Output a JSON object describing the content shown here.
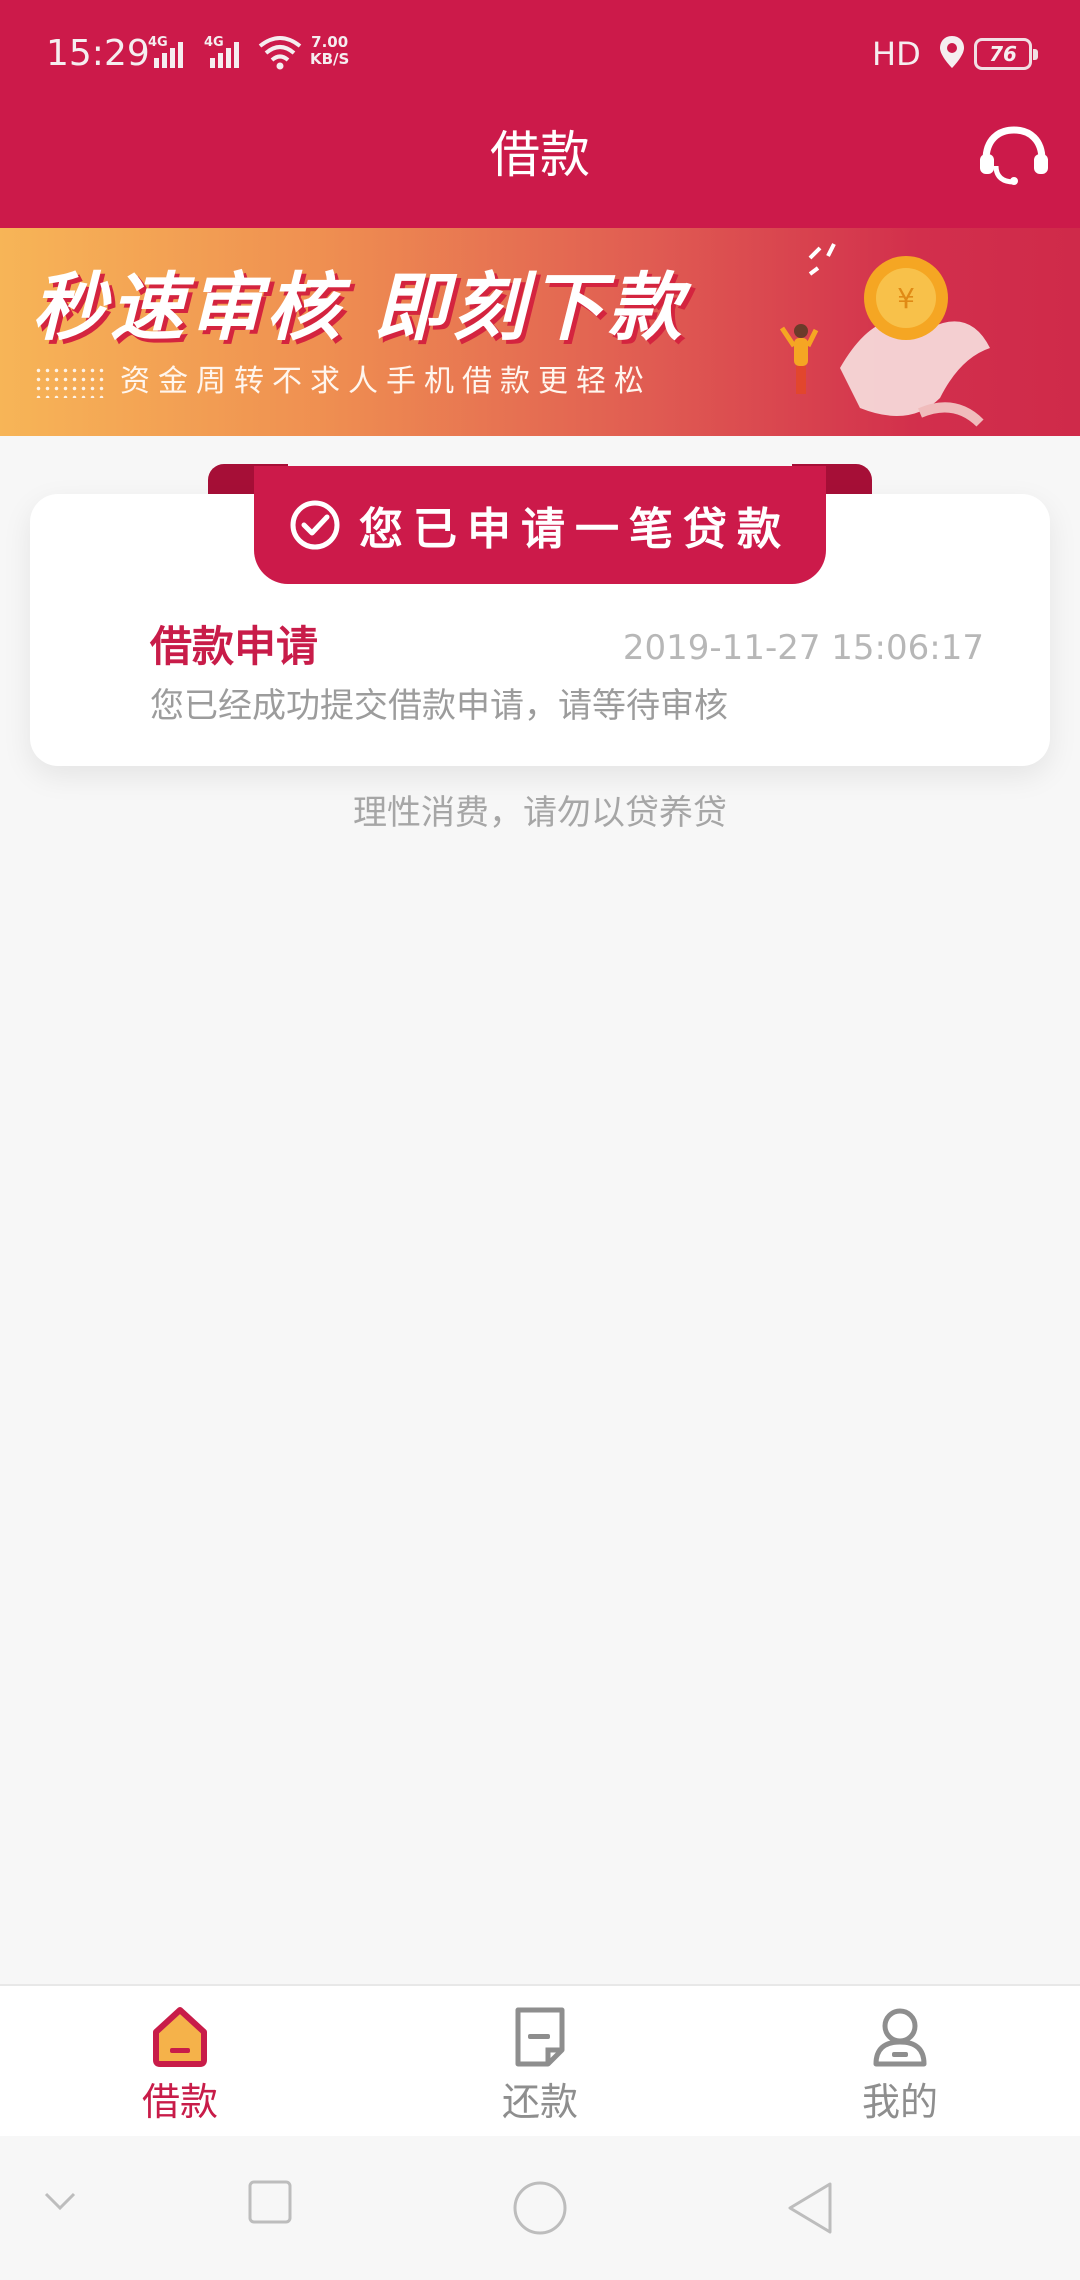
{
  "status_bar": {
    "time": "15:29",
    "signal_1": "4G",
    "signal_2": "4G",
    "speed_value": "7.00",
    "speed_unit": "KB/S",
    "hd": "HD",
    "battery": "76"
  },
  "header": {
    "title": "借款",
    "service_icon": "customer-service-headset-icon"
  },
  "banner": {
    "headline": "秒速审核 即刻下款",
    "subline": "资金周转不求人手机借款更轻松"
  },
  "application_card": {
    "ribbon_text": "您已申请一笔贷款",
    "title": "借款申请",
    "timestamp": "2019-11-27 15:06:17",
    "description": "您已经成功提交借款申请，请等待审核"
  },
  "tip": "理性消费，请勿以贷养贷",
  "tabbar": {
    "tabs": [
      {
        "label": "借款",
        "icon": "home-icon",
        "active": true
      },
      {
        "label": "还款",
        "icon": "document-icon",
        "active": false
      },
      {
        "label": "我的",
        "icon": "user-icon",
        "active": false
      }
    ]
  },
  "colors": {
    "brand": "#cc1a4a",
    "inactive": "#8e8e8e",
    "background": "#f7f7f7"
  }
}
